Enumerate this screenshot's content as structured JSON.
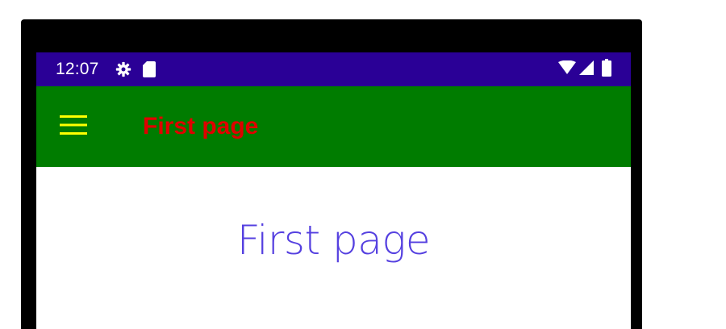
{
  "status_bar": {
    "time": "12:07",
    "icons": [
      "settings-gear-icon",
      "sd-card-icon",
      "wifi-icon",
      "cellular-signal-icon",
      "battery-icon"
    ],
    "background": "#2a0096"
  },
  "app_bar": {
    "title": "First page",
    "menu_icon": "hamburger-menu-icon",
    "background": "#007c00",
    "title_color": "#e00000",
    "icon_color": "#ffff00"
  },
  "main": {
    "heading": "First page",
    "heading_color": "#5540e0"
  }
}
